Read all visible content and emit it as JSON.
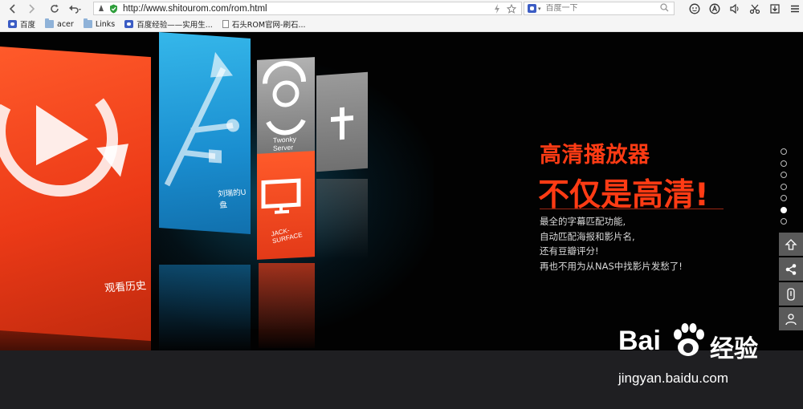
{
  "browser": {
    "toolbar": {
      "back_icon": "chevron-left-icon",
      "forward_icon": "chevron-right-icon",
      "reload_icon": "reload-icon",
      "undo_icon": "undo-icon",
      "address": {
        "url": "http://www.shitourom.com/rom.html",
        "secure_icon": "shield-check-icon",
        "lightning_icon": "lightning-icon",
        "star_icon": "star-icon"
      },
      "search": {
        "placeholder": "百度一下",
        "engine_icon": "baidu-icon",
        "search_icon": "magnifier-icon"
      },
      "right_icons": [
        "chat-icon",
        "a-circle-icon",
        "speaker-icon",
        "scissors-icon",
        "download-icon",
        "menu-icon"
      ]
    },
    "bookmarks": [
      {
        "label": "百度",
        "icon": "baidu-icon"
      },
      {
        "label": "acer",
        "icon": "folder-icon"
      },
      {
        "label": "Links",
        "icon": "folder-icon"
      },
      {
        "label": "百度经验——实用生...",
        "icon": "baidu-icon"
      },
      {
        "label": "石头ROM官网-刷石...",
        "icon": "page-icon"
      }
    ]
  },
  "banner": {
    "tiles": {
      "history": "观看历史",
      "usb": "刘瑞的U盘",
      "twonky": "Twonky Server",
      "jack": "JACK-SURFACE"
    },
    "headline_line1": "高清播放器",
    "headline_line2": "不仅是高清!",
    "description": [
      "最全的字幕匹配功能,",
      "自动匹配海报和影片名,",
      "还有豆瓣评分!",
      "再也不用为从NAS中找影片发愁了!"
    ],
    "slides": {
      "count": 7,
      "active": 6
    },
    "side_tools": [
      "back-to-top-icon",
      "share-icon",
      "clipboard-icon",
      "user-icon"
    ]
  },
  "watermark": {
    "brand": "Bai",
    "brand_cn": "经验",
    "url": "jingyan.baidu.com"
  },
  "colors": {
    "accent_red": "#ff3b14",
    "tile_blue": "#1a8ed0",
    "tile_red": "#ec3a17",
    "banner_bg": "#020202"
  }
}
